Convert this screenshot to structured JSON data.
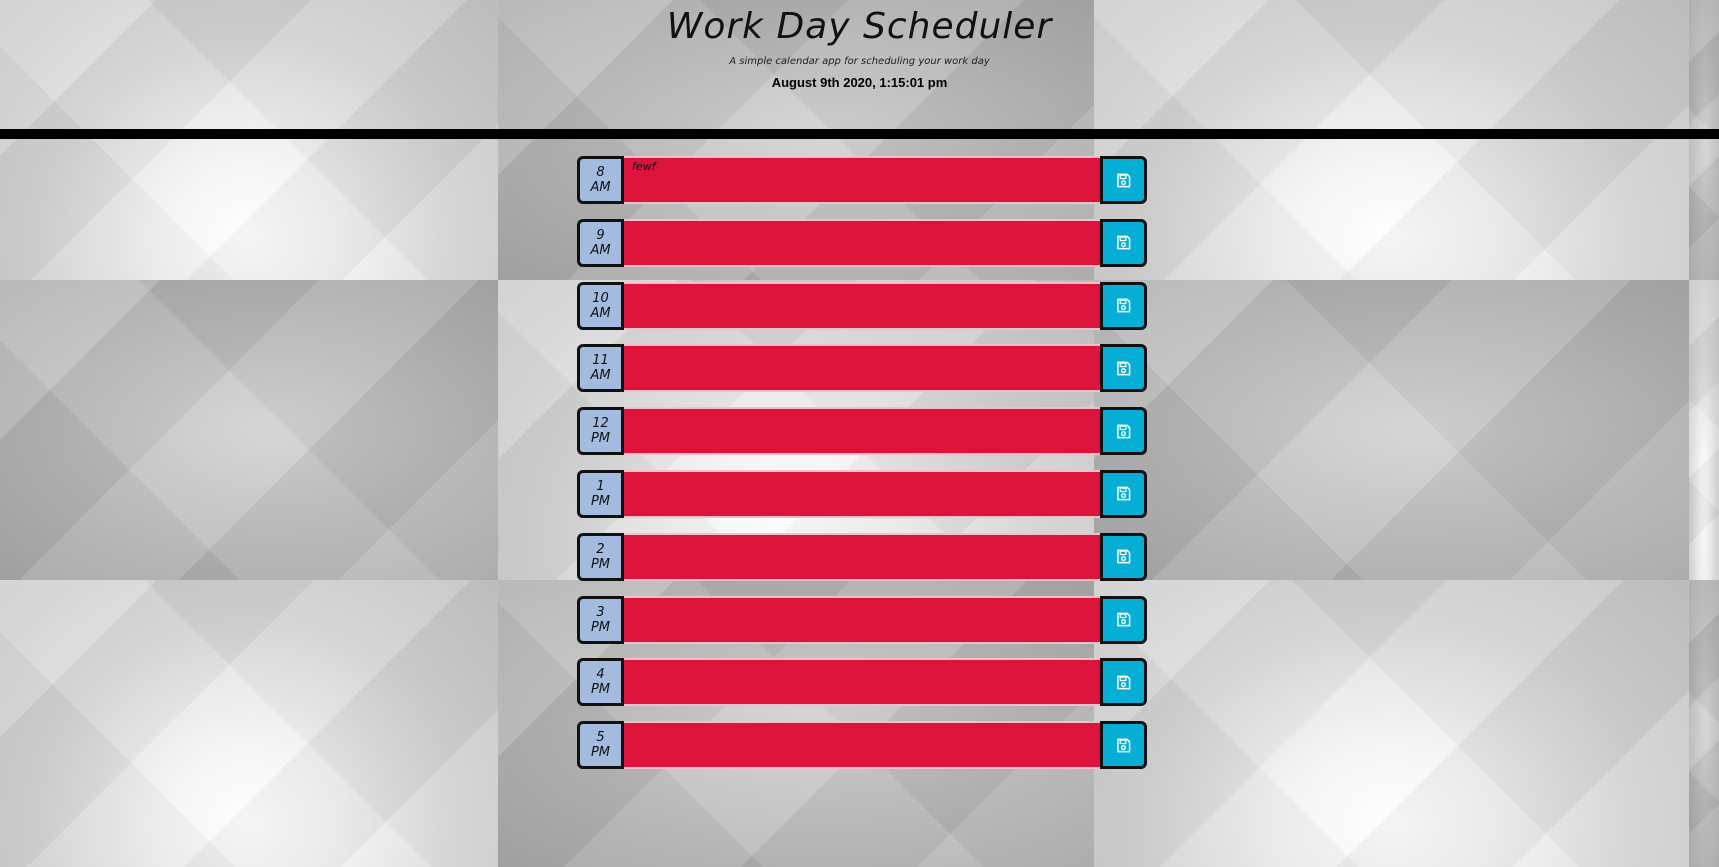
{
  "header": {
    "title": "Work Day Scheduler",
    "subtitle": "A simple calendar app for scheduling your work day",
    "current_day": "August 9th 2020, 1:15:01 pm"
  },
  "colors": {
    "past": "#dc143c",
    "hour_block": "#a3bbdf",
    "save_button": "#06aed5",
    "divider": "#000000"
  },
  "rows": [
    {
      "hour": "8",
      "meridiem": "AM",
      "task": "fewf"
    },
    {
      "hour": "9",
      "meridiem": "AM",
      "task": ""
    },
    {
      "hour": "10",
      "meridiem": "AM",
      "task": ""
    },
    {
      "hour": "11",
      "meridiem": "AM",
      "task": ""
    },
    {
      "hour": "12",
      "meridiem": "PM",
      "task": ""
    },
    {
      "hour": "1",
      "meridiem": "PM",
      "task": ""
    },
    {
      "hour": "2",
      "meridiem": "PM",
      "task": ""
    },
    {
      "hour": "3",
      "meridiem": "PM",
      "task": ""
    },
    {
      "hour": "4",
      "meridiem": "PM",
      "task": ""
    },
    {
      "hour": "5",
      "meridiem": "PM",
      "task": ""
    }
  ],
  "save_icon": "floppy-disk-icon"
}
